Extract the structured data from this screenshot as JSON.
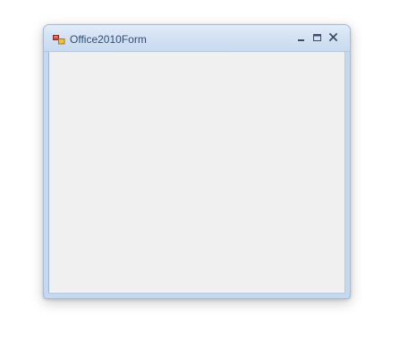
{
  "window": {
    "title": "Office2010Form",
    "controls": {
      "minimize_icon": "minimize-icon",
      "maximize_icon": "maximize-icon",
      "close_icon": "close-icon"
    },
    "app_icon": "form-app-icon"
  },
  "colors": {
    "title_text": "#2e4d78",
    "frame": "#c6d8ee",
    "client_background": "#f0f0f0"
  }
}
